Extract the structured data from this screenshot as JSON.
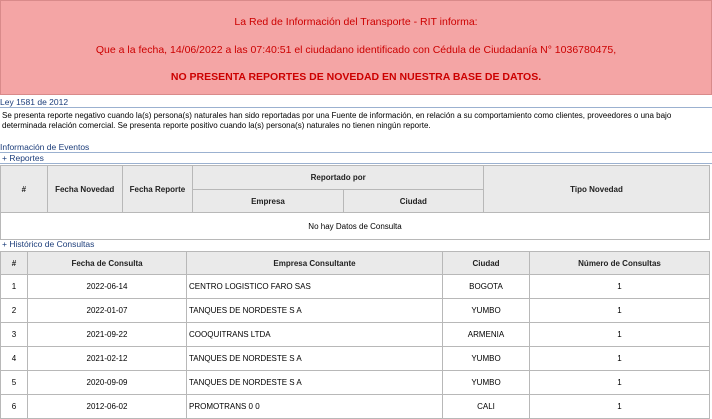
{
  "banner": {
    "line1": "La Red de Información del Transporte - RIT informa:",
    "line2": "Que a la fecha, 14/06/2022 a las 07:40:51 el ciudadano identificado con Cédula de Ciudadanía N° 1036780475,",
    "line3": "NO PRESENTA REPORTES DE NOVEDAD EN NUESTRA BASE DE DATOS."
  },
  "law": "Ley 1581 de 2012",
  "description": "Se presenta reporte negativo cuando la(s) persona(s) naturales han sido reportadas por una Fuente de información, en relación a su comportamiento como clientes, proveedores o una bajo determinada relación comercial. Se presenta reporte positivo cuando la(s) persona(s) naturales no tienen ningún reporte.",
  "events_title": "Información de Eventos",
  "reports_link": "+ Reportes",
  "reports": {
    "headers": {
      "num": "#",
      "fecha_novedad": "Fecha Novedad",
      "fecha_reporte": "Fecha Reporte",
      "reportado_por": "Reportado por",
      "empresa": "Empresa",
      "ciudad": "Ciudad",
      "tipo": "Tipo Novedad"
    },
    "empty": "No hay Datos de Consulta"
  },
  "history_link": "+ Histórico de Consultas",
  "history": {
    "headers": {
      "num": "#",
      "fecha": "Fecha de Consulta",
      "empresa": "Empresa Consultante",
      "ciudad": "Ciudad",
      "numero": "Número de Consultas"
    },
    "rows": [
      {
        "n": "1",
        "fecha": "2022-06-14",
        "empresa": "CENTRO LOGISTICO FARO SAS",
        "ciudad": "BOGOTA",
        "numero": "1"
      },
      {
        "n": "2",
        "fecha": "2022-01-07",
        "empresa": "TANQUES DE NORDESTE S A",
        "ciudad": "YUMBO",
        "numero": "1"
      },
      {
        "n": "3",
        "fecha": "2021-09-22",
        "empresa": "COOQUITRANS LTDA",
        "ciudad": "ARMENIA",
        "numero": "1"
      },
      {
        "n": "4",
        "fecha": "2021-02-12",
        "empresa": "TANQUES DE NORDESTE S A",
        "ciudad": "YUMBO",
        "numero": "1"
      },
      {
        "n": "5",
        "fecha": "2020-09-09",
        "empresa": "TANQUES DE NORDESTE S A",
        "ciudad": "YUMBO",
        "numero": "1"
      },
      {
        "n": "6",
        "fecha": "2012-06-02",
        "empresa": "PROMOTRANS 0 0",
        "ciudad": "CALI",
        "numero": "1"
      }
    ]
  }
}
